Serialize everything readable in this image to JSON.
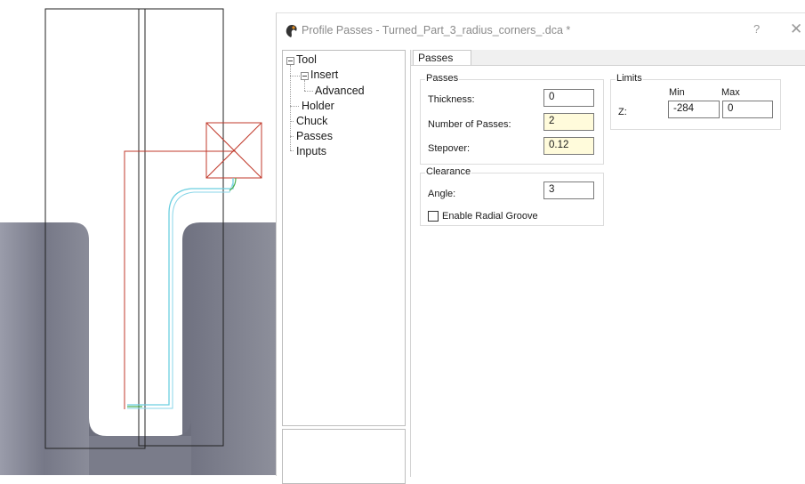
{
  "dialog": {
    "title": "Profile Passes - Turned_Part_3_radius_corners_.dca *",
    "help_glyph": "?",
    "close_glyph": "✕"
  },
  "tree": {
    "items": [
      {
        "label": "Tool"
      },
      {
        "label": "Insert"
      },
      {
        "label": "Advanced"
      },
      {
        "label": "Holder"
      },
      {
        "label": "Chuck"
      },
      {
        "label": "Passes"
      },
      {
        "label": "Inputs"
      }
    ]
  },
  "tabs": [
    {
      "label": "Passes"
    }
  ],
  "passes_group": {
    "title": "Passes",
    "thickness_label": "Thickness:",
    "thickness_value": "0",
    "num_passes_label": "Number of Passes:",
    "num_passes_value": "2",
    "stepover_label": "Stepover:",
    "stepover_value": "0.12"
  },
  "limits_group": {
    "title": "Limits",
    "min_header": "Min",
    "max_header": "Max",
    "z_label": "Z:",
    "z_min": "-284",
    "z_max": "0"
  },
  "clearance_group": {
    "title": "Clearance",
    "angle_label": "Angle:",
    "angle_value": "3",
    "radial_groove_label": "Enable Radial Groove",
    "radial_groove_checked": false
  },
  "colors": {
    "accent_field": "#fffbdb",
    "toolpath_cyan": "#6ccfe0",
    "toolpath_green": "#4caf50",
    "holder_red": "#c0392b",
    "part_gray": "#7e808e"
  }
}
